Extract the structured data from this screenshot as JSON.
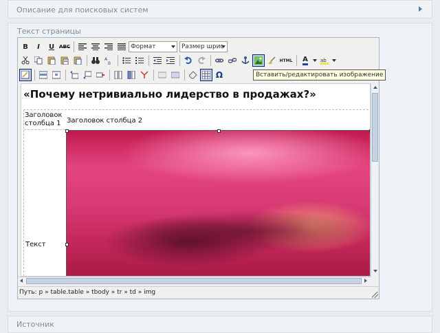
{
  "sections": {
    "seo_title": "Описание для поисковых систем",
    "page_text_title": "Текст страницы",
    "source_title": "Источник"
  },
  "toolbar": {
    "format_select": "Формат",
    "fontsize_select": "Размер шрифта",
    "bold": "B",
    "italic": "I",
    "underline": "U",
    "strike": "ABC",
    "html": "HTML",
    "omega": "Ω",
    "font_color": "A"
  },
  "tooltip": "Вставить/редактировать изображение",
  "content": {
    "heading": "«Почему нетривиально лидерство в продажах?»",
    "table": {
      "header1": "Заголовок столбца 1",
      "header2": "Заголовок столбца 2",
      "cell1": "Текст"
    }
  },
  "statusbar": "Путь: p » table.table » tbody » tr » td » img",
  "colors": {
    "active_button_bg": "#c2d0e6",
    "section_bg": "#eef2f6",
    "title_color": "#7f8d99"
  }
}
